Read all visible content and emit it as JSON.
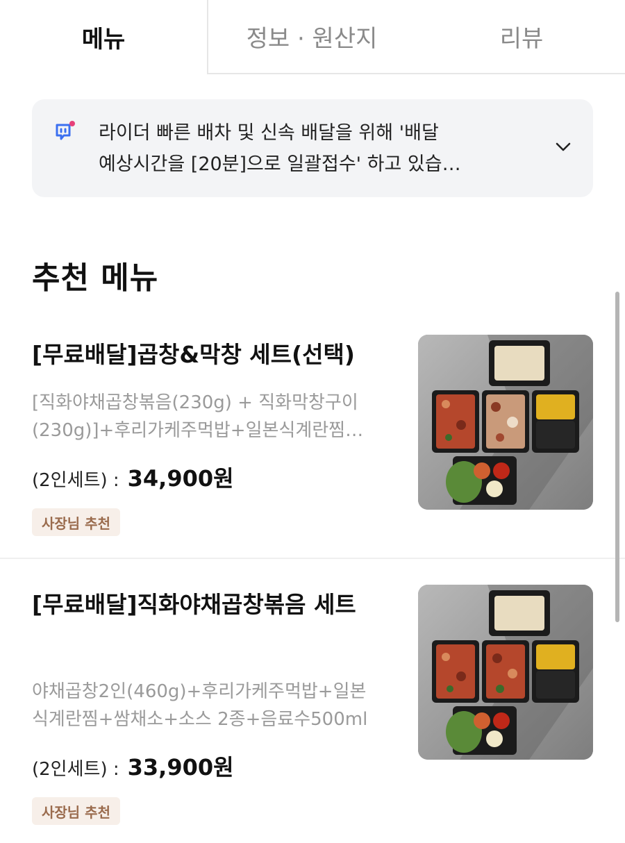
{
  "tabs": [
    {
      "label": "메뉴",
      "active": true
    },
    {
      "label": "정보 · 원산지",
      "active": false
    },
    {
      "label": "리뷰",
      "active": false
    }
  ],
  "notice": {
    "lines": [
      "라이더 빠른 배차 및 신속 배달을 위해 '배달",
      "예상시간을 [20분]으로 일괄접수' 하고 있습…"
    ],
    "icon": "megaphone-icon",
    "icon_color": "#3b6ff0",
    "dot_color": "#e6407a"
  },
  "section": {
    "title": "추천 메뉴"
  },
  "items": [
    {
      "name": "[무료배달]곱창&막창 세트(선택)",
      "desc_lines": [
        "[직화야채곱창볶음(230g) + 직화막창구이",
        "(230g)]+후리가케주먹밥+일본식계란찜…"
      ],
      "price_label": "(2인세트) :",
      "price": "34,900원",
      "badge": "사장님 추천"
    },
    {
      "name": "[무료배달]직화야채곱창볶음 세트",
      "desc_lines": [
        "야채곱창2인(460g)+후리가케주먹밥+일본",
        "식계란찜+쌈채소+소스 2종+음료수500ml"
      ],
      "price_label": "(2인세트) :",
      "price": "33,900원",
      "badge": "사장님 추천"
    }
  ],
  "colors": {
    "badge_bg": "#f7efe9",
    "badge_text": "#9a6b4d",
    "notice_bg": "#f3f4f6"
  }
}
